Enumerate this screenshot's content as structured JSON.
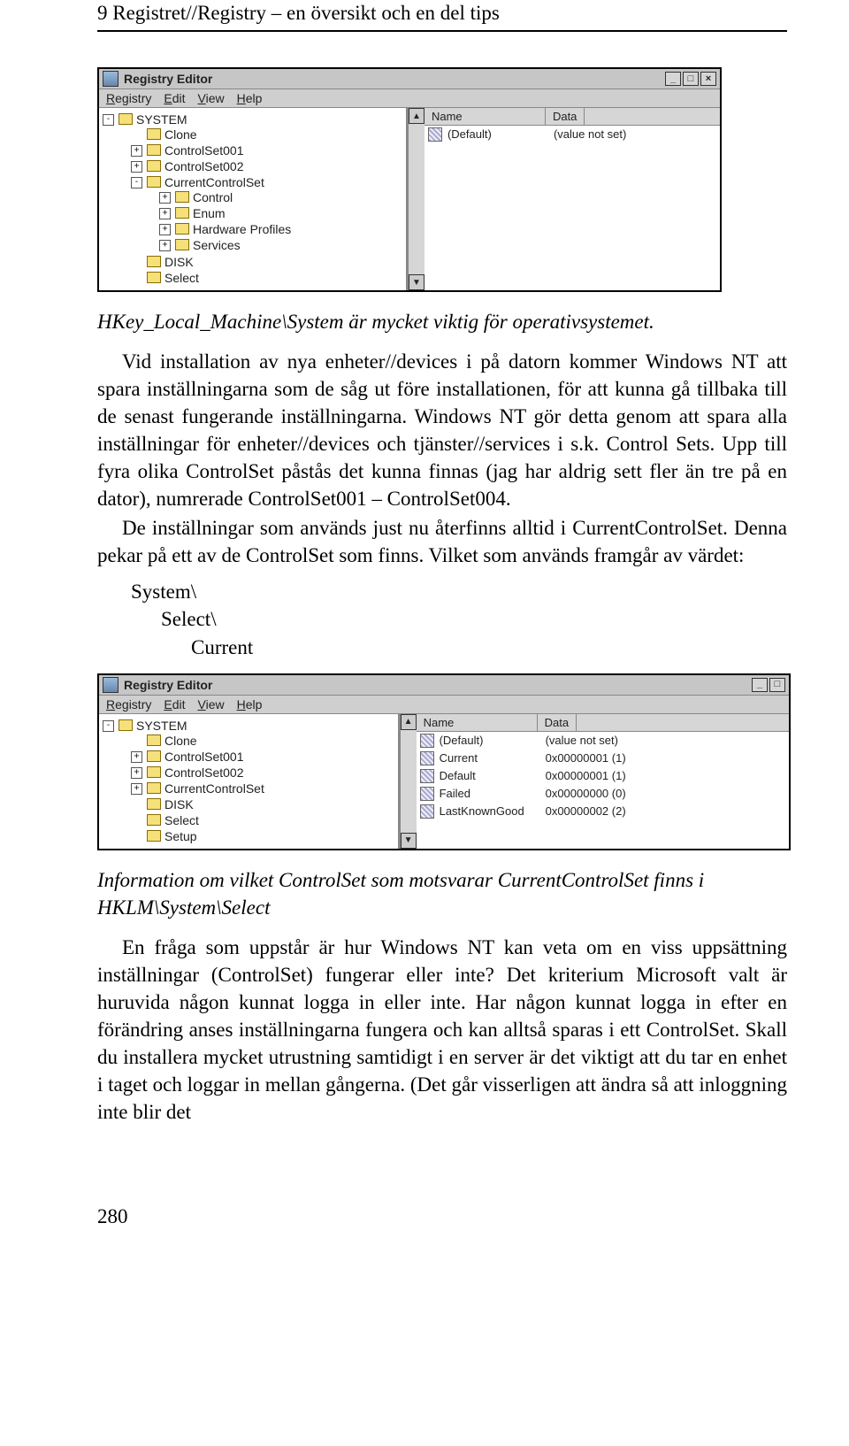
{
  "header": "9  Registret//Registry – en översikt och en del tips",
  "regedit1": {
    "title": "Registry Editor",
    "menu": [
      "Registry",
      "Edit",
      "View",
      "Help"
    ],
    "tree": [
      {
        "label": "SYSTEM",
        "exp": "-",
        "children": [
          {
            "label": "Clone"
          },
          {
            "label": "ControlSet001",
            "exp": "+"
          },
          {
            "label": "ControlSet002",
            "exp": "+"
          },
          {
            "label": "CurrentControlSet",
            "exp": "-",
            "children": [
              {
                "label": "Control",
                "exp": "+"
              },
              {
                "label": "Enum",
                "exp": "+"
              },
              {
                "label": "Hardware Profiles",
                "exp": "+"
              },
              {
                "label": "Services",
                "exp": "+"
              }
            ]
          },
          {
            "label": "DISK"
          },
          {
            "label": "Select"
          }
        ]
      }
    ],
    "cols": [
      "Name",
      "Data"
    ],
    "rows": [
      {
        "name": "(Default)",
        "data": "(value not set)"
      }
    ]
  },
  "caption1": "HKey_Local_Machine\\System är mycket viktig för operativsystemet.",
  "p1": "Vid installation av nya enheter//devices i på datorn kommer Windows NT att spara inställningarna som de såg ut före installationen, för att kunna gå tillbaka till de senast fungerande inställningarna. Windows NT gör detta genom att spara alla inställningar för enheter//devices och tjänster//services i s.k. Control Sets. Upp till fyra olika ControlSet påstås det kunna finnas (jag har aldrig sett fler än tre på en dator), numrerade ControlSet001 – ControlSet004.",
  "p2": "De inställningar som används just nu återfinns alltid i CurrentControlSet. Denna pekar på ett av de ControlSet som finns. Vilket som används framgår av värdet:",
  "pathblock": [
    "System\\",
    "Select\\",
    "Current"
  ],
  "regedit2": {
    "title": "Registry Editor",
    "menu": [
      "Registry",
      "Edit",
      "View",
      "Help"
    ],
    "tree": [
      {
        "label": "SYSTEM",
        "exp": "-",
        "children": [
          {
            "label": "Clone"
          },
          {
            "label": "ControlSet001",
            "exp": "+"
          },
          {
            "label": "ControlSet002",
            "exp": "+"
          },
          {
            "label": "CurrentControlSet",
            "exp": "+"
          },
          {
            "label": "DISK"
          },
          {
            "label": "Select"
          },
          {
            "label": "Setup"
          }
        ]
      }
    ],
    "cols": [
      "Name",
      "Data"
    ],
    "rows": [
      {
        "name": "(Default)",
        "data": "(value not set)"
      },
      {
        "name": "Current",
        "data": "0x00000001 (1)"
      },
      {
        "name": "Default",
        "data": "0x00000001 (1)"
      },
      {
        "name": "Failed",
        "data": "0x00000000 (0)"
      },
      {
        "name": "LastKnownGood",
        "data": "0x00000002 (2)"
      }
    ]
  },
  "caption2": "Information om vilket ControlSet som motsvarar CurrentControlSet finns i HKLM\\System\\Select",
  "p3": "En fråga som uppstår är hur Windows NT kan veta om en viss uppsättning inställningar (ControlSet) fungerar eller inte? Det kriterium Microsoft valt är huruvida någon kunnat logga in eller inte. Har någon kunnat logga in efter en förändring anses inställningarna fungera och kan alltså sparas i ett ControlSet. Skall du installera mycket utrustning samtidigt i en server är det viktigt att du tar en enhet i taget och loggar in mellan gångerna. (Det går visserligen att ändra så att inloggning inte blir det",
  "page_number": "280"
}
